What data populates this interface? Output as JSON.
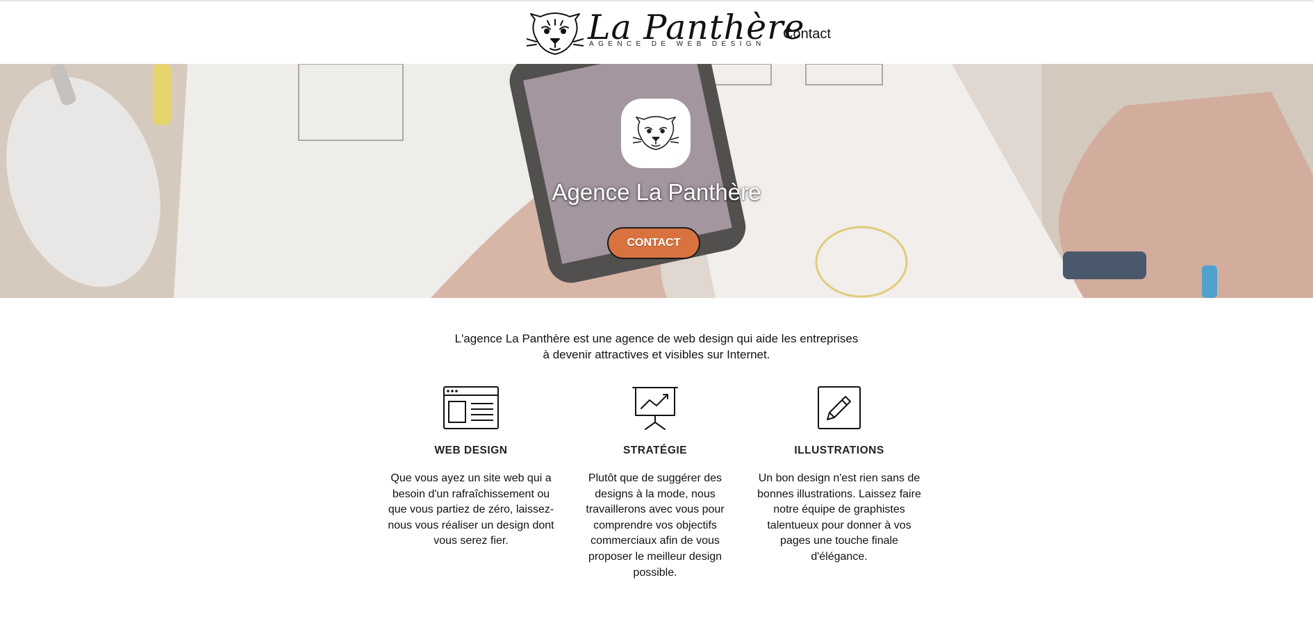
{
  "header": {
    "brand_name": "La Panthère",
    "brand_tagline": "AGENCE DE WEB DESIGN",
    "nav_contact": "Contact"
  },
  "hero": {
    "title": "Agence La Panthère",
    "cta_label": "CONTACT",
    "cta_color": "#d87340"
  },
  "intro": {
    "line1": "L'agence La Panthère est une agence de web design qui aide les entreprises",
    "line2": "à devenir attractives et visibles sur Internet."
  },
  "services": [
    {
      "icon": "browser-layout-icon",
      "title": "WEB DESIGN",
      "text": "Que vous ayez un site web qui a besoin d'un rafraîchissement ou que vous partiez de zéro, laissez-nous vous réaliser un design dont vous serez fier."
    },
    {
      "icon": "presentation-chart-icon",
      "title": "STRATÉGIE",
      "text": "Plutôt que de suggérer des designs à la mode, nous travaillerons avec vous pour comprendre vos objectifs commerciaux afin de vous proposer le meilleur design possible."
    },
    {
      "icon": "pencil-icon",
      "title": "ILLUSTRATIONS",
      "text": "Un bon design n'est rien sans de bonnes illustrations. Laissez faire notre équipe de graphistes talentueux pour donner à vos pages une touche finale d'élégance."
    }
  ]
}
